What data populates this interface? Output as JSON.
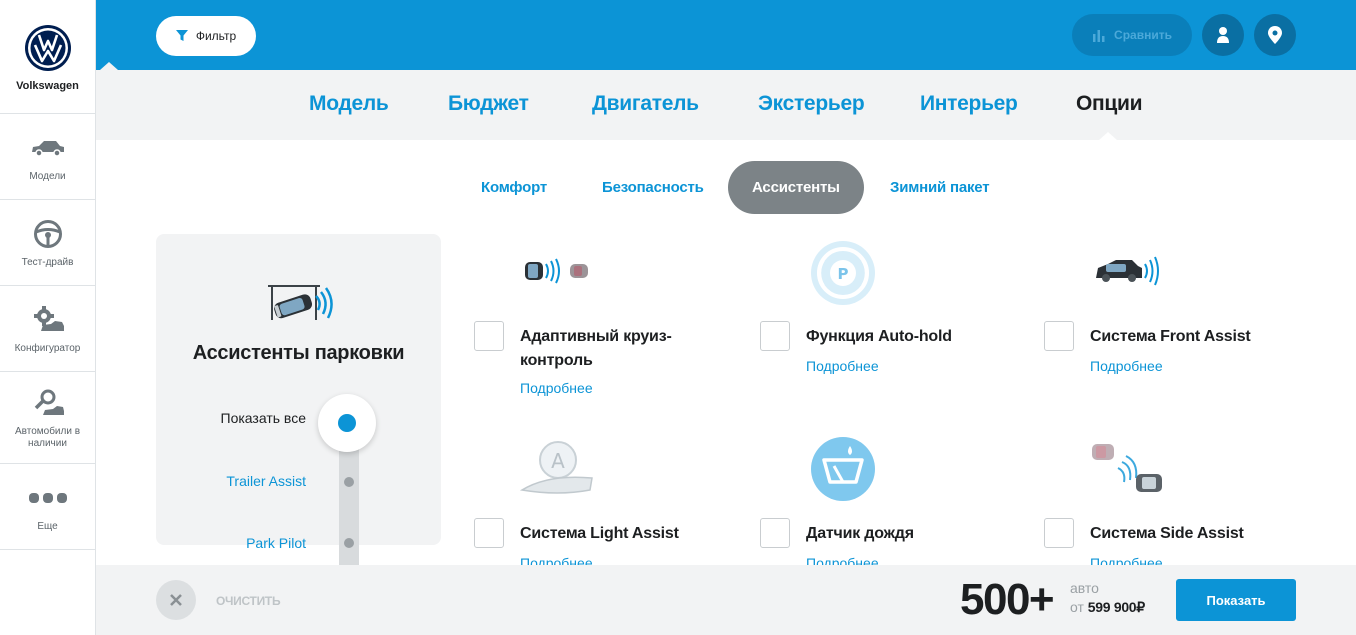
{
  "sidebar": {
    "brand": "Volkswagen",
    "items": [
      {
        "label": "Модели",
        "icon": "car-icon"
      },
      {
        "label": "Тест-драйв",
        "icon": "steering-wheel-icon"
      },
      {
        "label": "Конфигуратор",
        "icon": "configurator-icon"
      },
      {
        "label": "Автомобили в наличии",
        "icon": "car-search-icon"
      },
      {
        "label": "Еще",
        "icon": "more-dots-icon"
      }
    ]
  },
  "header": {
    "filter_label": "Фильтр",
    "compare_label": "Сравнить",
    "accent_color": "#0c94d6"
  },
  "main_tabs": [
    "Модель",
    "Бюджет",
    "Двигатель",
    "Экстерьер",
    "Интерьер",
    "Опции"
  ],
  "main_tab_active": "Опции",
  "sub_tabs": [
    "Комфорт",
    "Безопасность",
    "Ассистенты",
    "Зимний пакет"
  ],
  "sub_tab_active": "Ассистенты",
  "panel": {
    "title": "Ассистенты парковки",
    "options": [
      "Показать все",
      "Trailer Assist",
      "Park Pilot"
    ],
    "selected": "Показать все"
  },
  "features": [
    {
      "title": "Адаптивный круиз-контроль",
      "more": "Подробнее",
      "checked": false
    },
    {
      "title": "Функция Auto-hold",
      "more": "Подробнее",
      "checked": false
    },
    {
      "title": "Система Front Assist",
      "more": "Подробнее",
      "checked": false
    },
    {
      "title": "Система Light Assist",
      "more": "Подробнее",
      "checked": false
    },
    {
      "title": "Датчик дождя",
      "more": "Подробнее",
      "checked": false
    },
    {
      "title": "Система Side Assist",
      "more": "Подробнее",
      "checked": false
    }
  ],
  "footer": {
    "clear_label": "ОЧИСТИТЬ",
    "count": "500+",
    "unit": "авто",
    "price_prefix": "от",
    "price": "599 900₽",
    "show_label": "Показать"
  }
}
